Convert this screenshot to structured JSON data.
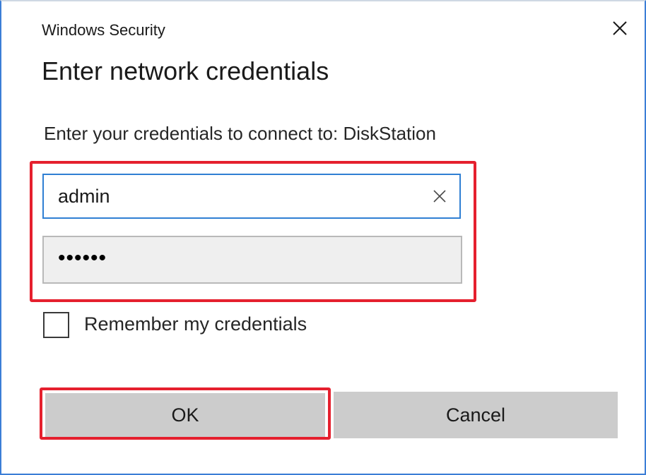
{
  "window": {
    "title": "Windows Security",
    "close_icon": "close-icon"
  },
  "dialog": {
    "heading": "Enter network credentials",
    "prompt": "Enter your credentials to connect to: DiskStation"
  },
  "form": {
    "username_value": "admin",
    "password_value": "••••••",
    "clear_icon": "clear-x-icon",
    "remember_label": "Remember my credentials",
    "remember_checked": false
  },
  "buttons": {
    "ok_label": "OK",
    "cancel_label": "Cancel"
  },
  "colors": {
    "accent": "#2f7fd3",
    "highlight": "#e5202e",
    "button_bg": "#cccccc",
    "password_bg": "#efefef"
  }
}
